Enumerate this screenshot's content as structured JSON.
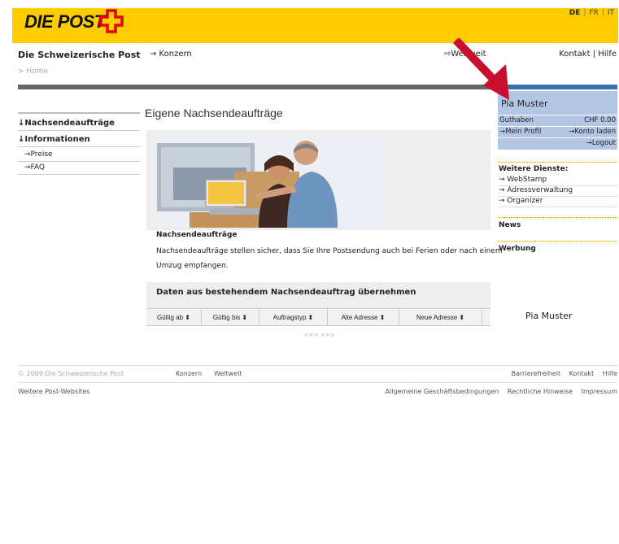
{
  "header": {
    "logo_text": "DIE POST",
    "languages": [
      {
        "code": "DE",
        "active": true
      },
      {
        "code": "FR",
        "active": false
      },
      {
        "code": "IT",
        "active": false
      }
    ],
    "brand_colors": {
      "yellow": "#ffcc00",
      "red": "#e2001a",
      "blue": "#3a6fb0",
      "light_blue": "#b3c7e5"
    }
  },
  "topnav": {
    "site_name": "Die Schweizerische Post",
    "konzern": "→ Konzern",
    "weltweit": "Weltweit",
    "kontakt": "Kontakt",
    "sep": " | ",
    "hilfe": "Hilfe"
  },
  "breadcrumb": "> Home",
  "left_nav": [
    {
      "label": "↓Nachsendeaufträge"
    },
    {
      "label": "↓Informationen"
    },
    {
      "label": "→Preise"
    },
    {
      "label": "→FAQ"
    }
  ],
  "main": {
    "title": "Eigene Nachsendeaufträge",
    "section_title": "Nachsendeaufträge",
    "section_text_1": "Nachsendeaufträge stellen sicher, dass Sie Ihre Postsendung auch bei Ferien oder nach einem",
    "section_text_2": "Umzug empfangen.",
    "takeover_title": "Daten aus bestehendem Nachsendeauftrag übernehmen",
    "table_headers": [
      "Gültig ab ⬍",
      "Gültig bis ⬍",
      "Auftragstyp ⬍",
      "Alte Adresse ⬍",
      "Neue Adresse ⬍"
    ],
    "pager": "<<< >>>"
  },
  "user": {
    "name": "Pia Muster",
    "guthaben_label": "Guthaben",
    "guthaben_value": "CHF 0.00",
    "profil": "→Mein Profil",
    "konto": "→Konto laden",
    "logout": "→Logout"
  },
  "services": {
    "title": "Weitere Dienste:",
    "items": [
      "→ WebStamp",
      "→ Adressverwaltung",
      "→ Organizer"
    ]
  },
  "news_title": "News",
  "werbung_title": "Werbung",
  "bottom_user_name": "Pia Muster",
  "footer": {
    "copyright": "© 2009 Die Schweizerische Post",
    "konzern": "Konzern",
    "weltweit": "Weltweit",
    "barrierefreiheit": "Barrierefreiheit",
    "kontakt": "Kontakt",
    "hilfe": "Hilfe",
    "more_sites": "Weitere Post-Websites",
    "agb": "Allgemeine Geschäftsbedingungen",
    "rechtliche": "Rechtliche Hinweise",
    "impressum": "Impressum"
  }
}
